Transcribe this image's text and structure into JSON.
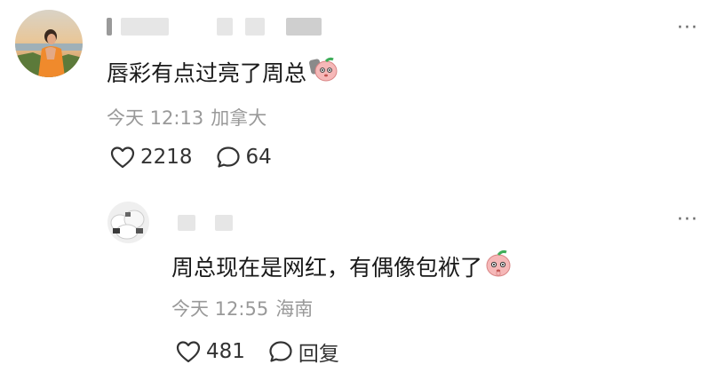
{
  "comments": [
    {
      "text": "唇彩有点过亮了周总",
      "time": "今天 12:13",
      "location": "加拿大",
      "likes": "2218",
      "replies": "64",
      "emoji_icon": "peach-emoji-icon"
    },
    {
      "text": "周总现在是网红，有偶像包袱了",
      "time": "今天 12:55",
      "location": "海南",
      "likes": "481",
      "reply_label": "回复",
      "emoji_icon": "peach-emoji-icon"
    }
  ],
  "more_label": "···",
  "colors": {
    "text": "#1a1a1a",
    "meta": "#999999",
    "icon": "#333333",
    "username_blur": "#e6e6e6"
  },
  "icons": {
    "like": "heart-outline-icon",
    "comment": "speech-bubble-icon",
    "more": "more-dots-icon"
  }
}
